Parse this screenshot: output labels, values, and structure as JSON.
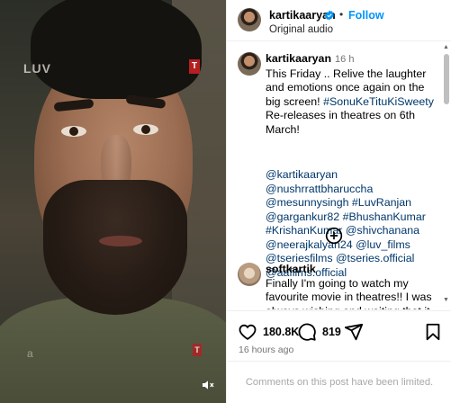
{
  "post": {
    "username": "kartikaaryan",
    "verified": true,
    "follow_label": "Follow",
    "dot": "•",
    "audio_label": "Original audio",
    "video_watermarks": {
      "left": "LUV",
      "right": "T",
      "bottom_left": "a",
      "bottom_right": "T"
    }
  },
  "caption": {
    "username": "kartikaaryan",
    "time": "16 h",
    "text": "This Friday .. Relive the laughter and emotions once again on the big screen! ",
    "hashtag": "#SonuKeTituKiSweety",
    "text2": " Re-releases in theatres on 6th March!",
    "tags": "@kartikaaryan @nushrrattbharuccha @mesunnysingh #LuvRanjan @gargankur82 #BhushanKumar #KrishanKumar @shivchanana @neerajkalyan24 @luv_films @tseriesfilms @tseries.official @aafilms.official"
  },
  "comment": {
    "username": "softkartik",
    "text": "Finally I'm going to watch my favourite movie in theatres!! I was always wishing and waiting that it"
  },
  "actions": {
    "likes": "180.8K",
    "comments": "819",
    "posted_ago": "16 hours ago"
  },
  "footer": {
    "limited_text": "Comments on this post have been limited."
  },
  "colors": {
    "accent": "#0095f6",
    "link": "#00376b",
    "muted": "#737373"
  },
  "icons": [
    "verified-icon",
    "heart-icon",
    "comment-icon",
    "share-icon",
    "bookmark-icon",
    "add-circle-icon",
    "mute-icon"
  ]
}
